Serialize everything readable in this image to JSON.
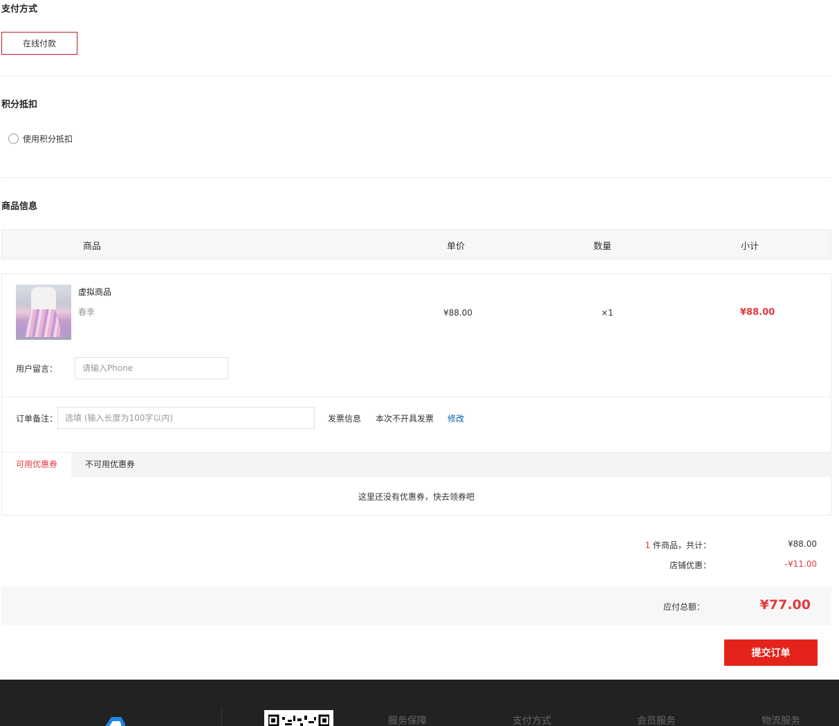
{
  "payment": {
    "title": "支付方式",
    "option": "在线付款"
  },
  "points": {
    "title": "积分抵扣",
    "option": "使用积分抵扣"
  },
  "goods": {
    "title": "商品信息",
    "headers": {
      "product": "商品",
      "price": "单价",
      "qty": "数量",
      "subtotal": "小计"
    },
    "item": {
      "name": "虚拟商品",
      "spec": "春季",
      "price": "¥88.00",
      "qty": "×1",
      "subtotal": "¥88.00"
    },
    "message": {
      "label": "用户留言：",
      "placeholder": "请输入Phone"
    },
    "remark": {
      "label": "订单备注：",
      "placeholder": "选填 (输入长度为100字以内)"
    },
    "invoice": {
      "label": "发票信息",
      "value": "本次不开具发票",
      "edit": "修改"
    },
    "coupons": {
      "tab_available": "可用优惠券",
      "tab_unavailable": "不可用优惠券",
      "empty": "这里还没有优惠券，快去领券吧"
    }
  },
  "summary": {
    "count": "1",
    "count_label": "件商品，共计：",
    "total": "¥88.00",
    "discount_label": "店铺优惠：",
    "discount": "-¥11.00",
    "payable_label": "应付总额：",
    "payable": "¥77.00"
  },
  "submit_label": "提交订单",
  "footer": {
    "links": [
      "服务保障",
      "支付方式",
      "会员服务",
      "物流服务"
    ]
  },
  "colors": {
    "accent": "#e4393c",
    "button": "#e4231b",
    "link": "#005ea7",
    "footer_bg": "#222222"
  }
}
